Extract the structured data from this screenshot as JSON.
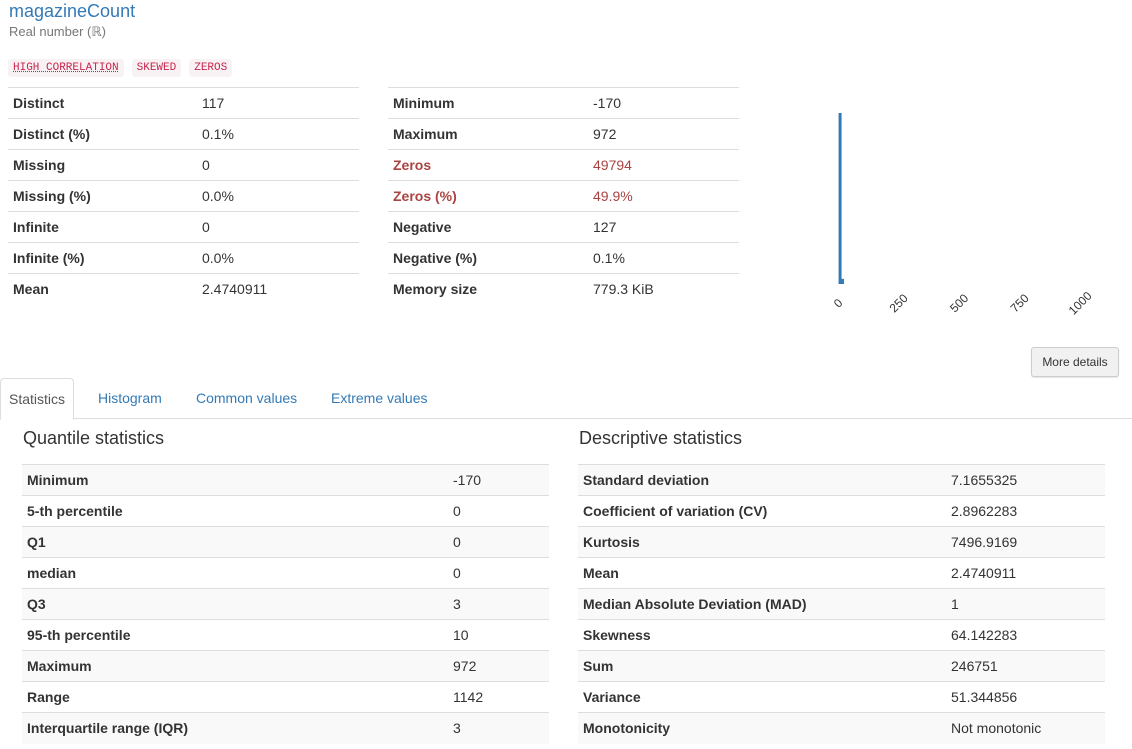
{
  "variable": {
    "name": "magazineCount",
    "type": "Real number (ℝ)"
  },
  "badges": [
    {
      "label": "HIGH CORRELATION",
      "underline": true
    },
    {
      "label": "SKEWED",
      "underline": false
    },
    {
      "label": "ZEROS",
      "underline": false
    }
  ],
  "overview_left": [
    {
      "label": "Distinct",
      "value": "117"
    },
    {
      "label": "Distinct (%)",
      "value": "0.1%"
    },
    {
      "label": "Missing",
      "value": "0"
    },
    {
      "label": "Missing (%)",
      "value": "0.0%"
    },
    {
      "label": "Infinite",
      "value": "0"
    },
    {
      "label": "Infinite (%)",
      "value": "0.0%"
    },
    {
      "label": "Mean",
      "value": "2.4740911"
    }
  ],
  "overview_right": [
    {
      "label": "Minimum",
      "value": "-170",
      "alert": false
    },
    {
      "label": "Maximum",
      "value": "972",
      "alert": false
    },
    {
      "label": "Zeros",
      "value": "49794",
      "alert": true
    },
    {
      "label": "Zeros (%)",
      "value": "49.9%",
      "alert": true
    },
    {
      "label": "Negative",
      "value": "127",
      "alert": false
    },
    {
      "label": "Negative (%)",
      "value": "0.1%",
      "alert": false
    },
    {
      "label": "Memory size",
      "value": "779.3 KiB",
      "alert": false
    }
  ],
  "colors": {
    "link": "#337ab7",
    "alert": "#a94442",
    "badge_text": "#c7254e",
    "badge_bg": "#f9f2f4",
    "bar": "#337ab7"
  },
  "chart_data": {
    "type": "bar",
    "x_ticks": [
      "0",
      "250",
      "500",
      "750",
      "1000"
    ],
    "x_range": [
      -170,
      1100
    ],
    "bars": [
      {
        "x_start": -10,
        "x_end": 0,
        "relative_height": 1.0
      },
      {
        "x_start": 0,
        "x_end": 10,
        "relative_height": 0.03
      }
    ],
    "grid": false
  },
  "buttons": {
    "more_details": "More details"
  },
  "tabs": [
    {
      "label": "Statistics",
      "active": true
    },
    {
      "label": "Histogram",
      "active": false
    },
    {
      "label": "Common values",
      "active": false
    },
    {
      "label": "Extreme values",
      "active": false
    }
  ],
  "quantile": {
    "title": "Quantile statistics",
    "rows": [
      {
        "label": "Minimum",
        "value": "-170"
      },
      {
        "label": "5-th percentile",
        "value": "0"
      },
      {
        "label": "Q1",
        "value": "0"
      },
      {
        "label": "median",
        "value": "0"
      },
      {
        "label": "Q3",
        "value": "3"
      },
      {
        "label": "95-th percentile",
        "value": "10"
      },
      {
        "label": "Maximum",
        "value": "972"
      },
      {
        "label": "Range",
        "value": "1142"
      },
      {
        "label": "Interquartile range (IQR)",
        "value": "3"
      }
    ]
  },
  "descriptive": {
    "title": "Descriptive statistics",
    "rows": [
      {
        "label": "Standard deviation",
        "value": "7.1655325"
      },
      {
        "label": "Coefficient of variation (CV)",
        "value": "2.8962283"
      },
      {
        "label": "Kurtosis",
        "value": "7496.9169"
      },
      {
        "label": "Mean",
        "value": "2.4740911"
      },
      {
        "label": "Median Absolute Deviation (MAD)",
        "value": "1"
      },
      {
        "label": "Skewness",
        "value": "64.142283"
      },
      {
        "label": "Sum",
        "value": "246751"
      },
      {
        "label": "Variance",
        "value": "51.344856"
      },
      {
        "label": "Monotonicity",
        "value": "Not monotonic"
      }
    ]
  }
}
